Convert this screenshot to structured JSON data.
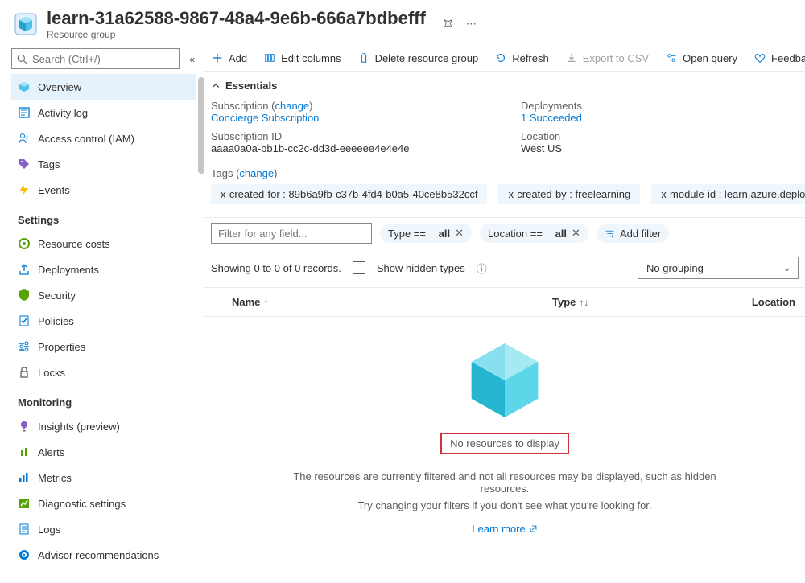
{
  "header": {
    "title": "learn-31a62588-9867-48a4-9e6b-666a7bdbefff",
    "subtitle": "Resource group"
  },
  "search": {
    "placeholder": "Search (Ctrl+/)"
  },
  "sidebar": {
    "items": [
      {
        "label": "Overview",
        "selected": true
      },
      {
        "label": "Activity log"
      },
      {
        "label": "Access control (IAM)"
      },
      {
        "label": "Tags"
      },
      {
        "label": "Events"
      }
    ],
    "groups": [
      {
        "header": "Settings",
        "items": [
          {
            "label": "Resource costs"
          },
          {
            "label": "Deployments"
          },
          {
            "label": "Security"
          },
          {
            "label": "Policies"
          },
          {
            "label": "Properties"
          },
          {
            "label": "Locks"
          }
        ]
      },
      {
        "header": "Monitoring",
        "items": [
          {
            "label": "Insights (preview)"
          },
          {
            "label": "Alerts"
          },
          {
            "label": "Metrics"
          },
          {
            "label": "Diagnostic settings"
          },
          {
            "label": "Logs"
          },
          {
            "label": "Advisor recommendations"
          }
        ]
      }
    ]
  },
  "toolbar": {
    "add": "Add",
    "editcols": "Edit columns",
    "deleterg": "Delete resource group",
    "refresh": "Refresh",
    "exportcsv": "Export to CSV",
    "openquery": "Open query",
    "feedback": "Feedback"
  },
  "essentials": {
    "header": "Essentials",
    "sub_label": "Subscription",
    "sub_change": "change",
    "sub_link": "Concierge Subscription",
    "subid_label": "Subscription ID",
    "subid_val": "aaaa0a0a-bb1b-cc2c-dd3d-eeeeee4e4e4e",
    "dep_label": "Deployments",
    "dep_val": "1 Succeeded",
    "loc_label": "Location",
    "loc_val": "West US",
    "tags_label": "Tags",
    "tags_change": "change",
    "tag1": "x-created-for : 89b6a9fb-c37b-4fd4-b0a5-40ce8b532ccf",
    "tag2": "x-created-by : freelearning",
    "tag3": "x-module-id : learn.azure.deploy-az"
  },
  "filters": {
    "placeholder": "Filter for any field...",
    "type_label": "Type ==",
    "type_val": "all",
    "loc_label": "Location ==",
    "loc_val": "all",
    "add": "Add filter"
  },
  "listing": {
    "showing": "Showing 0 to 0 of 0 records.",
    "hidden": "Show hidden types",
    "grouping": "No grouping",
    "col_name": "Name",
    "col_type": "Type",
    "col_loc": "Location"
  },
  "empty": {
    "title": "No resources to display",
    "line1": "The resources are currently filtered and not all resources may be displayed, such as hidden resources.",
    "line2": "Try changing your filters if you don't see what you're looking for.",
    "learn": "Learn more"
  }
}
